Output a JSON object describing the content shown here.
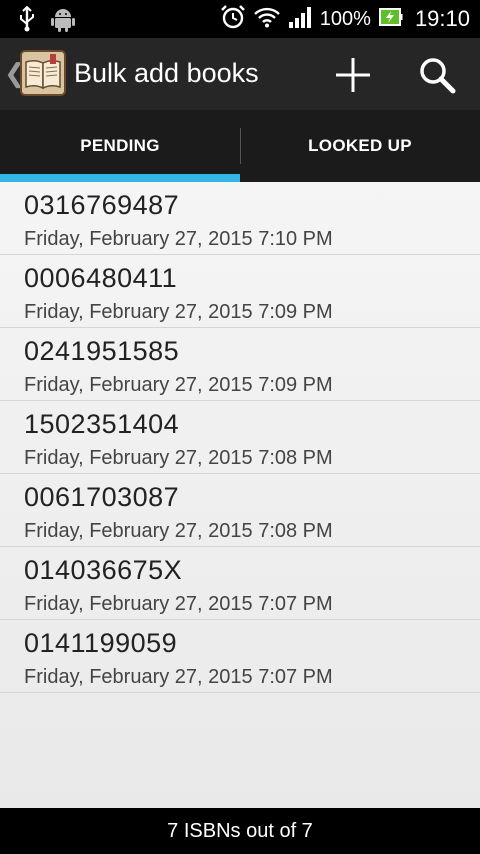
{
  "status_bar": {
    "battery": "100%",
    "time": "19:10"
  },
  "action_bar": {
    "title": "Bulk add books"
  },
  "tabs": [
    {
      "label": "PENDING",
      "selected": true
    },
    {
      "label": "LOOKED UP",
      "selected": false
    }
  ],
  "accent_color": "#33b5e5",
  "items": [
    {
      "isbn": "0316769487",
      "date": "Friday, February 27, 2015 7:10 PM"
    },
    {
      "isbn": "0006480411",
      "date": "Friday, February 27, 2015 7:09 PM"
    },
    {
      "isbn": "0241951585",
      "date": "Friday, February 27, 2015 7:09 PM"
    },
    {
      "isbn": "1502351404",
      "date": "Friday, February 27, 2015 7:08 PM"
    },
    {
      "isbn": "0061703087",
      "date": "Friday, February 27, 2015 7:08 PM"
    },
    {
      "isbn": "014036675X",
      "date": "Friday, February 27, 2015 7:07 PM"
    },
    {
      "isbn": "0141199059",
      "date": "Friday, February 27, 2015 7:07 PM"
    }
  ],
  "footer": {
    "text": "7 ISBNs out of 7"
  }
}
